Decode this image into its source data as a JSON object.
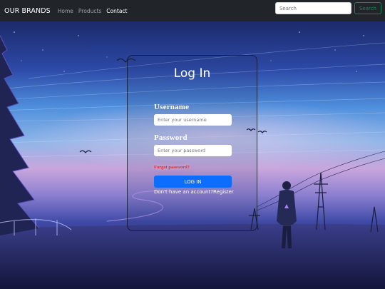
{
  "navbar": {
    "brand": "OUR BRANDS",
    "links": [
      {
        "label": "Home"
      },
      {
        "label": "Products"
      },
      {
        "label": "Contact"
      }
    ],
    "search": {
      "placeholder": "Search",
      "button_label": "Search"
    }
  },
  "login": {
    "title": "Log In",
    "username_label": "Username",
    "username_placeholder": "Enter your username",
    "password_label": "Password",
    "password_placeholder": "Enter your password",
    "forgot_label": "Forgot password?",
    "submit_label": "LOG IN",
    "no_account_text": "Don't have an account?",
    "register_label": "Register"
  },
  "colors": {
    "navbar_bg": "#212529",
    "primary_button": "#0d6efd",
    "search_button": "#198754",
    "forgot_text": "#e3262e"
  },
  "icons": [
    "bird-icon",
    "power-tower-icon",
    "tree-icon",
    "person-figure"
  ]
}
